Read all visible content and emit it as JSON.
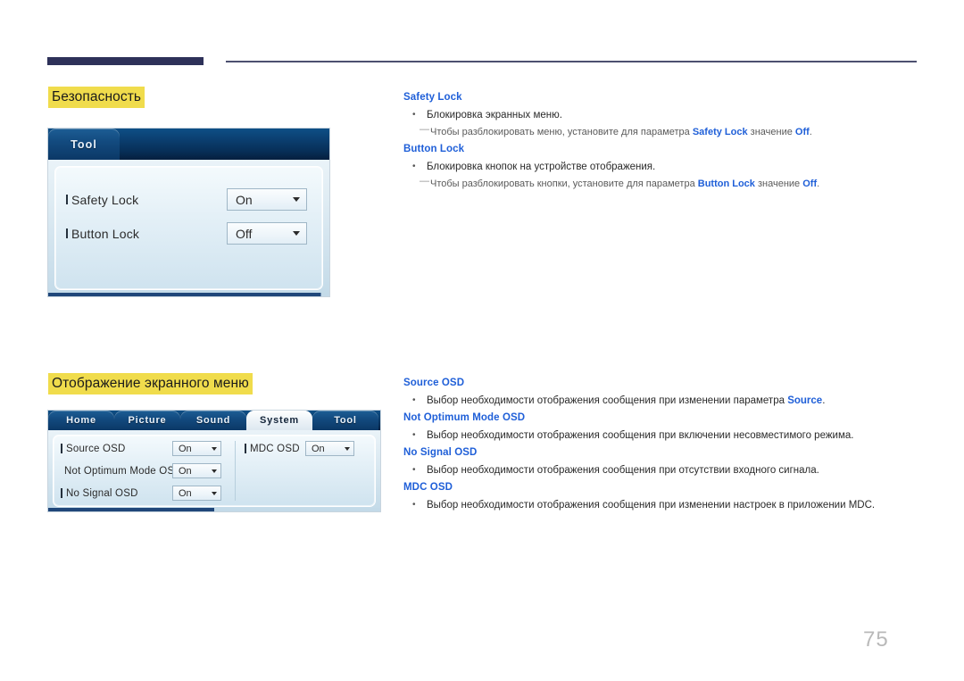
{
  "page": {
    "number": "75"
  },
  "sections": [
    {
      "heading": "Безопасность",
      "panel": {
        "tabs": [
          {
            "label": "Tool",
            "active": false
          }
        ],
        "rows": [
          {
            "label": "Safety Lock",
            "value": "On"
          },
          {
            "label": "Button Lock",
            "value": "Off"
          }
        ]
      },
      "entries": [
        {
          "term": "Safety Lock",
          "bullet": "Блокировка экранных меню.",
          "note_before": "Чтобы разблокировать меню, установите для параметра ",
          "note_kw1": "Safety Lock",
          "note_mid": " значение ",
          "note_kw2": "Off",
          "note_after": "."
        },
        {
          "term": "Button Lock",
          "bullet": "Блокировка кнопок на устройстве отображения.",
          "note_before": "Чтобы разблокировать кнопки, установите для параметра ",
          "note_kw1": "Button Lock",
          "note_mid": " значение ",
          "note_kw2": "Off",
          "note_after": "."
        }
      ]
    },
    {
      "heading": "Отображение экранного меню",
      "panel": {
        "tabs": [
          {
            "label": "Home",
            "active": false
          },
          {
            "label": "Picture",
            "active": false
          },
          {
            "label": "Sound",
            "active": false
          },
          {
            "label": "System",
            "active": true
          },
          {
            "label": "Tool",
            "active": false
          }
        ],
        "rows_left": [
          {
            "label": "Source OSD",
            "value": "On"
          },
          {
            "label": "Not Optimum Mode OSD",
            "value": "On"
          },
          {
            "label": "No Signal OSD",
            "value": "On"
          }
        ],
        "rows_right": [
          {
            "label": "MDC OSD",
            "value": "On"
          }
        ]
      },
      "entries": [
        {
          "term": "Source OSD",
          "bullet_before": "Выбор необходимости отображения сообщения при изменении параметра ",
          "bullet_kw": "Source",
          "bullet_after": "."
        },
        {
          "term": "Not Optimum Mode OSD",
          "bullet_before": "Выбор необходимости отображения сообщения при включении несовместимого режима.",
          "bullet_kw": "",
          "bullet_after": ""
        },
        {
          "term": "No Signal OSD",
          "bullet_before": "Выбор необходимости отображения сообщения при отсутствии входного сигнала.",
          "bullet_kw": "",
          "bullet_after": ""
        },
        {
          "term": "MDC OSD",
          "bullet_before": "Выбор необходимости отображения сообщения при изменении настроек в приложении MDC.",
          "bullet_kw": "",
          "bullet_after": ""
        }
      ]
    }
  ],
  "glyphs": {
    "bullet_dot": "•",
    "note_dash": "—",
    "caret_down": "▾"
  },
  "colors": {
    "heading_highlight": "#f0dc4c",
    "link_blue": "#1f5fd8",
    "rule_dark": "#2e3159",
    "osd_header": "#0b3f70"
  }
}
